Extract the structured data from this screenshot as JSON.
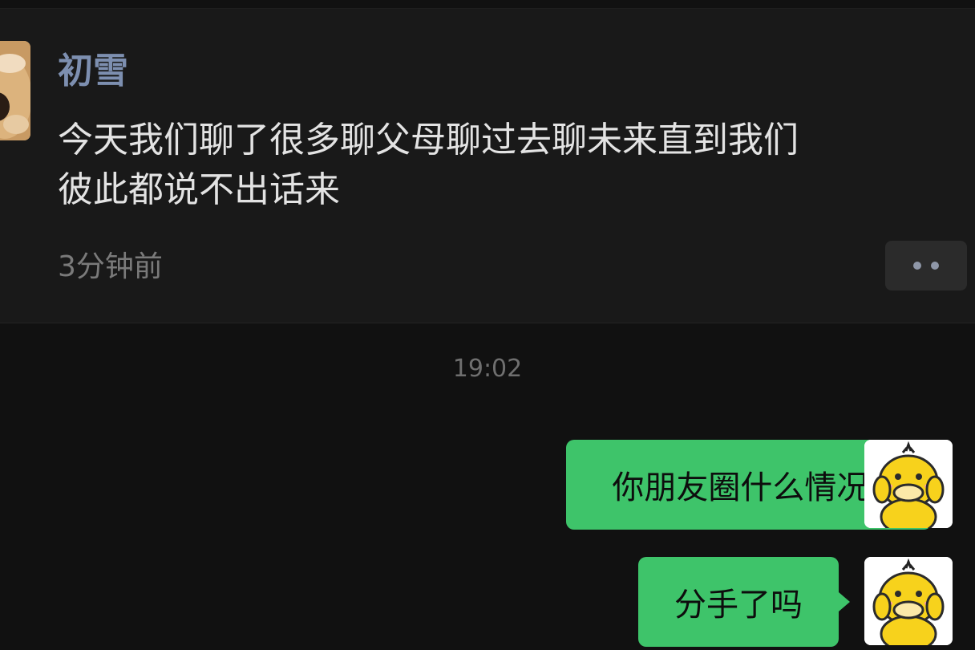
{
  "moment": {
    "author": "初雪",
    "text": "今天我们聊了很多聊父母聊过去聊未来直到我们\n彼此都说不出话来",
    "time": "3分钟前"
  },
  "chat": {
    "timestamp": "19:02",
    "messages": [
      {
        "text": "你朋友圈什么情况?"
      },
      {
        "text": "分手了吗"
      }
    ]
  },
  "colors": {
    "background": "#111111",
    "card": "#191919",
    "author_name": "#7d8fb0",
    "bubble_green": "#3ec46a"
  },
  "icons": {
    "more": "more-dots-icon",
    "author_avatar": "dog-avatar",
    "my_avatar": "yellow-duck-avatar"
  }
}
